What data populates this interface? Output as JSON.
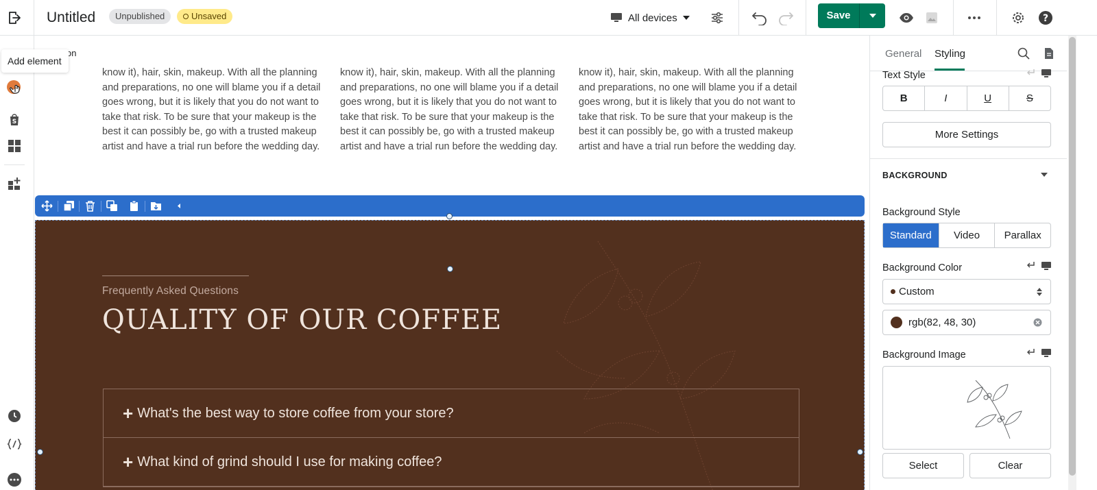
{
  "topbar": {
    "title": "Untitled",
    "badge_unpublished": "Unpublished",
    "badge_unsaved": "Unsaved",
    "devices_label": "All devices",
    "save_label": "Save"
  },
  "leftbar": {
    "tooltip": "Add element"
  },
  "canvas": {
    "breadcrumb": "on",
    "columns": [
      {
        "text": "know it), hair, skin, makeup. With all the planning and preparations, no one will blame you if a detail goes wrong, but it is likely that you do not want to take that risk. To be sure that your makeup is the best it can possibly be, go with a trusted makeup artist and have a trial run before the wedding day."
      },
      {
        "text": "know it), hair, skin, makeup. With all the planning and preparations, no one will blame you if a detail goes wrong, but it is likely that you do not want to take that risk. To be sure that your makeup is the best it can possibly be, go with a trusted makeup artist and have a trial run before the wedding day."
      },
      {
        "text": "know it), hair, skin, makeup. With all the planning and preparations, no one will blame you if a detail goes wrong, but it is likely that you do not want to take that risk. To be sure that your makeup is the best it can possibly be, go with a trusted makeup artist and have a trial run before the wedding day."
      }
    ],
    "faq": {
      "subtitle": "Frequently Asked Questions",
      "title": "QUALITY OF OUR COFFEE",
      "items": [
        {
          "q": "What's the best way to store coffee from your store?"
        },
        {
          "q": "What kind of grind should I use for making coffee?"
        }
      ]
    }
  },
  "panel": {
    "tabs": [
      {
        "label": "General"
      },
      {
        "label": "Styling"
      }
    ],
    "text_style_label": "Text Style",
    "format_buttons": [
      "B",
      "I",
      "U",
      "S"
    ],
    "more_settings": "More Settings",
    "background_header": "BACKGROUND",
    "bg_style_label": "Background Style",
    "bg_styles": [
      "Standard",
      "Video",
      "Parallax"
    ],
    "bg_color_label": "Background Color",
    "bg_color_select": "Custom",
    "bg_color_value": "rgb(82, 48, 30)",
    "bg_image_label": "Background Image",
    "select_label": "Select",
    "clear_label": "Clear"
  },
  "colors": {
    "accent": "#007a5a",
    "selection": "#2c6ecb",
    "section_bg": "#52301e"
  }
}
